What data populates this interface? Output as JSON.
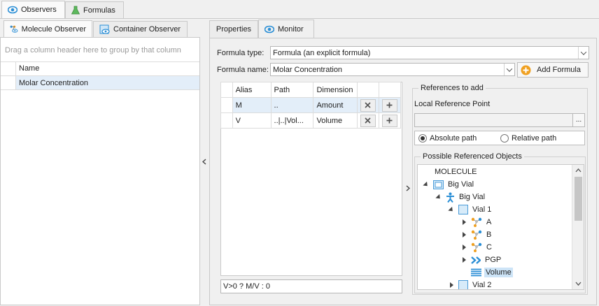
{
  "top_tabs": [
    {
      "label": "Observers",
      "active": true
    },
    {
      "label": "Formulas",
      "active": false
    }
  ],
  "left": {
    "tabs": [
      {
        "label": "Molecule Observer",
        "active": true
      },
      {
        "label": "Container Observer",
        "active": false
      }
    ],
    "group_hint": "Drag a column header here to group by that column",
    "column_name": "Name",
    "rows": [
      "Molar Concentration"
    ]
  },
  "right": {
    "tabs": [
      {
        "label": "Properties",
        "active": false
      },
      {
        "label": "Monitor",
        "active": true
      }
    ],
    "formula_type_label": "Formula type:",
    "formula_type_value": "Formula (an explicit formula)",
    "formula_name_label": "Formula name:",
    "formula_name_value": "Molar Concentration",
    "add_formula_label": "Add Formula",
    "grid": {
      "headers": [
        "Alias",
        "Path",
        "Dimension"
      ],
      "rows": [
        {
          "alias": "M",
          "path": "..",
          "dimension": "Amount"
        },
        {
          "alias": "V",
          "path": "..|..|Vol...",
          "dimension": "Volume"
        }
      ]
    },
    "formula_text": "V>0 ? M/V : 0",
    "references": {
      "title": "References to add",
      "local_ref_label": "Local Reference Point",
      "local_ref_value": "",
      "browse_label": "...",
      "absolute_label": "Absolute path",
      "relative_label": "Relative path",
      "absolute_selected": true,
      "possible_title": "Possible Referenced Objects",
      "tree": [
        {
          "label": "MOLECULE",
          "level": 0,
          "icon": "none",
          "expander": "none"
        },
        {
          "label": "Big Vial",
          "level": 0,
          "icon": "container-icon",
          "expander": "expanded"
        },
        {
          "label": "Big Vial",
          "level": 1,
          "icon": "organism-icon",
          "expander": "expanded"
        },
        {
          "label": "Vial 1",
          "level": 2,
          "icon": "compartment-icon",
          "expander": "expanded"
        },
        {
          "label": "A",
          "level": 3,
          "icon": "molecule-icon",
          "expander": "collapsed"
        },
        {
          "label": "B",
          "level": 3,
          "icon": "molecule-icon",
          "expander": "collapsed"
        },
        {
          "label": "C",
          "level": 3,
          "icon": "molecule-icon",
          "expander": "collapsed"
        },
        {
          "label": "PGP",
          "level": 3,
          "icon": "parameter-icon",
          "expander": "collapsed"
        },
        {
          "label": "Volume",
          "level": 3,
          "icon": "list-icon",
          "expander": "none",
          "selected": true
        },
        {
          "label": "Vial 2",
          "level": 2,
          "icon": "compartment-icon",
          "expander": "collapsed"
        }
      ]
    }
  },
  "colors": {
    "accent": "#2b8fd6",
    "orange": "#f0a020",
    "selection": "#cde4f7",
    "green": "#4caf50"
  }
}
